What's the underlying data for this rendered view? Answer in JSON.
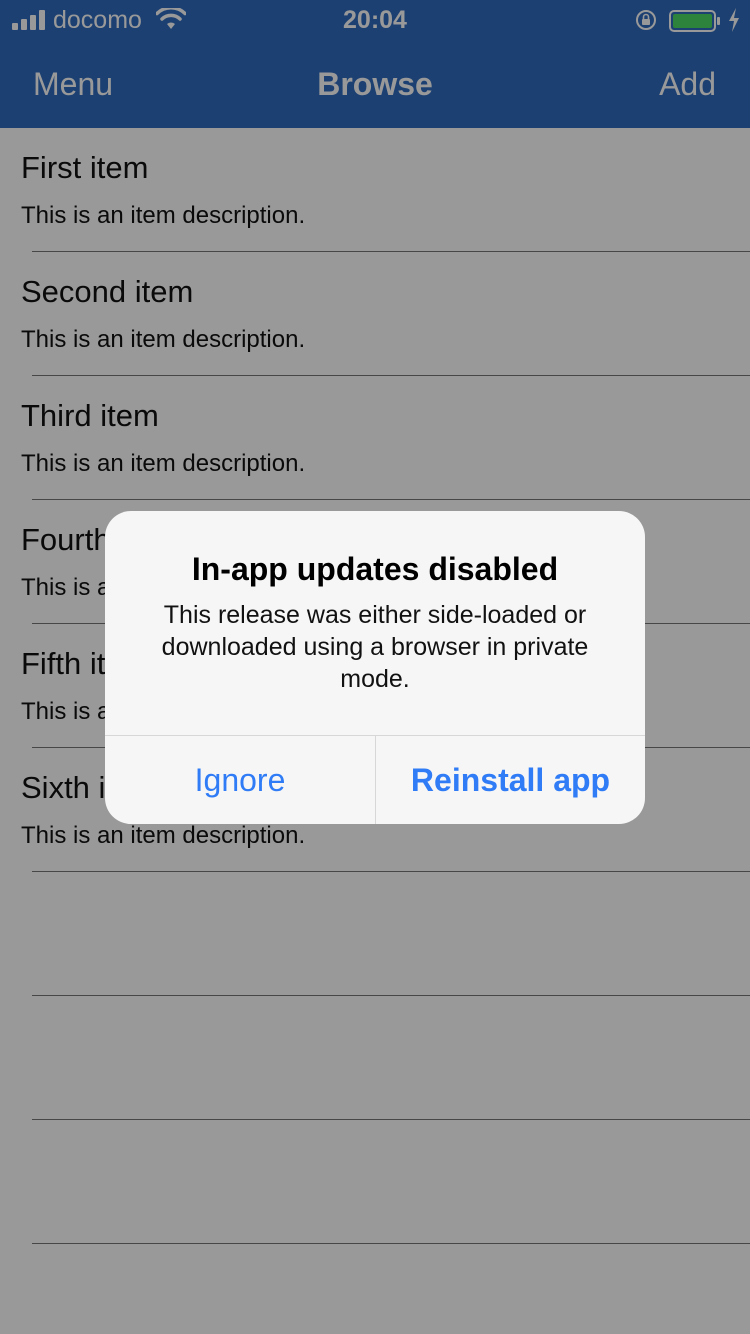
{
  "status_bar": {
    "carrier": "docomo",
    "time": "20:04"
  },
  "nav": {
    "left_label": "Menu",
    "title": "Browse",
    "right_label": "Add"
  },
  "items": [
    {
      "title": "First item",
      "description": "This is an item description."
    },
    {
      "title": "Second item",
      "description": "This is an item description."
    },
    {
      "title": "Third item",
      "description": "This is an item description."
    },
    {
      "title": "Fourth item",
      "description": "This is an item description."
    },
    {
      "title": "Fifth item",
      "description": "This is an item description."
    },
    {
      "title": "Sixth item",
      "description": "This is an item description."
    }
  ],
  "alert": {
    "title": "In-app updates disabled",
    "message": "This release was either side-loaded or downloaded using a browser in private mode.",
    "ignore_label": "Ignore",
    "reinstall_label": "Reinstall app"
  },
  "colors": {
    "header": "#2f6bbe",
    "alert_button": "#2f7cf6",
    "battery": "#4cd964"
  }
}
